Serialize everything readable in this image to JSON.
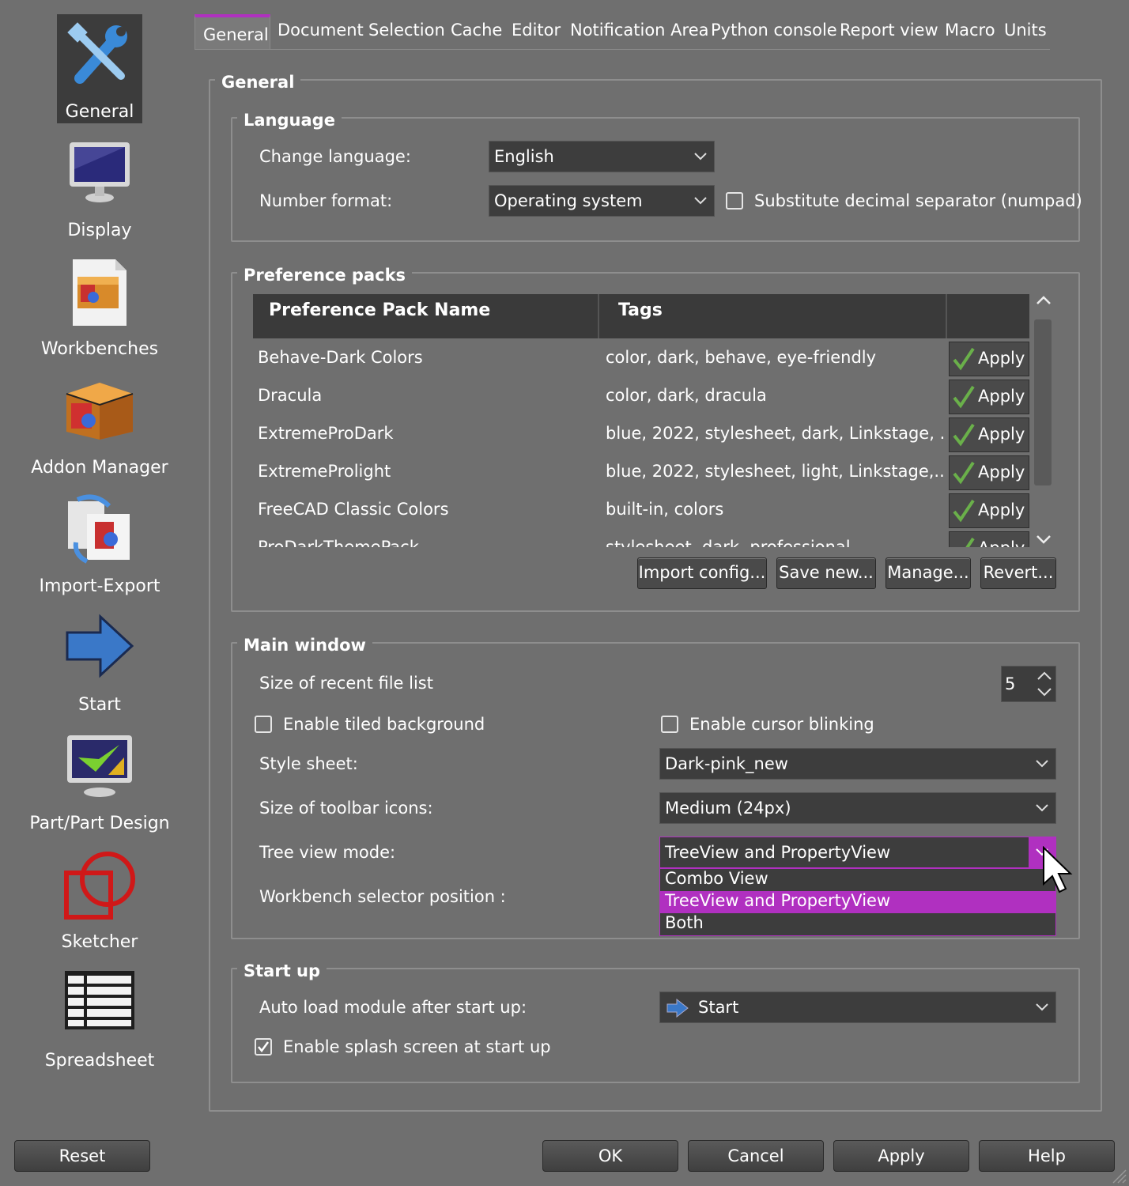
{
  "sidebar": {
    "items": [
      {
        "label": "General",
        "icon": "tools-icon",
        "active": true
      },
      {
        "label": "Display",
        "icon": "monitor-icon"
      },
      {
        "label": "Workbenches",
        "icon": "workbenches-icon"
      },
      {
        "label": "Addon Manager",
        "icon": "addon-box-icon"
      },
      {
        "label": "Import-Export",
        "icon": "import-export-icon"
      },
      {
        "label": "Start",
        "icon": "arrow-right-icon"
      },
      {
        "label": "Part/Part Design",
        "icon": "part-design-icon"
      },
      {
        "label": "Sketcher",
        "icon": "sketcher-icon"
      },
      {
        "label": "Spreadsheet",
        "icon": "spreadsheet-icon"
      }
    ]
  },
  "tabs": [
    "General",
    "Document",
    "Selection",
    "Cache",
    "Editor",
    "Notification Area",
    "Python console",
    "Report view",
    "Macro",
    "Units"
  ],
  "general_group": {
    "title": "General"
  },
  "language": {
    "title": "Language",
    "change_language_label": "Change language:",
    "change_language_value": "English",
    "number_format_label": "Number format:",
    "number_format_value": "Operating system",
    "substitute_label": "Substitute decimal separator (numpad)",
    "substitute_checked": false
  },
  "preference_packs": {
    "title": "Preference packs",
    "headers": [
      "Preference Pack Name",
      "Tags"
    ],
    "apply_label": "Apply",
    "rows": [
      {
        "name": "Behave-Dark Colors",
        "tags": "color, dark, behave, eye-friendly"
      },
      {
        "name": "Dracula",
        "tags": "color, dark, dracula"
      },
      {
        "name": "ExtremeProDark",
        "tags": "blue, 2022, stylesheet, dark, Linkstage, ..."
      },
      {
        "name": "ExtremeProlight",
        "tags": "blue, 2022, stylesheet, light, Linkstage,..."
      },
      {
        "name": "FreeCAD Classic Colors",
        "tags": "built-in, colors"
      },
      {
        "name": "ProDarkThemePack",
        "tags": "stylesheet, dark, professional"
      }
    ],
    "buttons": {
      "import": "Import config...",
      "save_new": "Save new...",
      "manage": "Manage...",
      "revert": "Revert..."
    }
  },
  "main_window": {
    "title": "Main window",
    "recent_files_label": "Size of recent file list",
    "recent_files_value": "5",
    "tiled_bg_label": "Enable tiled background",
    "tiled_bg_checked": false,
    "cursor_blink_label": "Enable cursor blinking",
    "cursor_blink_checked": false,
    "style_sheet_label": "Style sheet:",
    "style_sheet_value": "Dark-pink_new",
    "toolbar_icons_label": "Size of toolbar icons:",
    "toolbar_icons_value": "Medium (24px)",
    "tree_view_label": "Tree view mode:",
    "tree_view_value": "TreeView and PropertyView",
    "tree_view_options": [
      "Combo View",
      "TreeView and PropertyView",
      "Both"
    ],
    "workbench_selector_label": "Workbench selector position :"
  },
  "start_up": {
    "title": "Start up",
    "auto_load_label": "Auto load module after start up:",
    "auto_load_value": "Start",
    "splash_label": "Enable splash screen at start up",
    "splash_checked": true
  },
  "footer": {
    "reset": "Reset",
    "ok": "OK",
    "cancel": "Cancel",
    "apply": "Apply",
    "help": "Help"
  },
  "colors": {
    "accent": "#b030c0",
    "background": "#6f6f6f",
    "field": "#3d3d3d"
  }
}
